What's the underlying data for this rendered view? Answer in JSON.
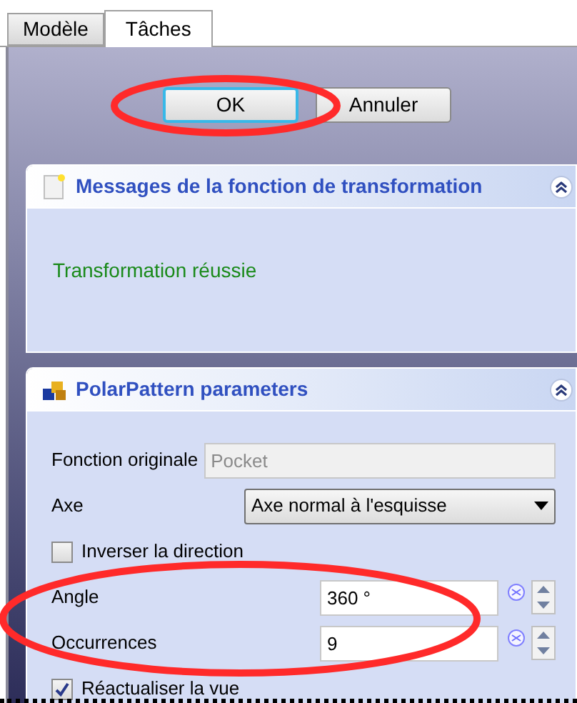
{
  "tabs": [
    {
      "label": "Modèle",
      "selected": false
    },
    {
      "label": "Tâches",
      "selected": true
    }
  ],
  "buttons": [
    {
      "label": "OK",
      "focused": true
    },
    {
      "label": "Annuler",
      "focused": false
    }
  ],
  "messages_panel": {
    "title": "Messages de la fonction de transformation",
    "message": "Transformation réussie",
    "expanded": true
  },
  "parameters_panel": {
    "title": "PolarPattern parameters",
    "expanded": true,
    "original_feature": {
      "label": "Fonction originale",
      "value": "Pocket",
      "disabled": true
    },
    "axis": {
      "label": "Axe",
      "value": "Axe normal à l'esquisse"
    },
    "reverse": {
      "label": "Inverser la direction",
      "checked": false
    },
    "angle": {
      "label": "Angle",
      "value": "360 °"
    },
    "occurrences": {
      "label": "Occurrences",
      "value": "9"
    },
    "update_view": {
      "label": "Réactualiser la vue",
      "checked": true
    }
  }
}
